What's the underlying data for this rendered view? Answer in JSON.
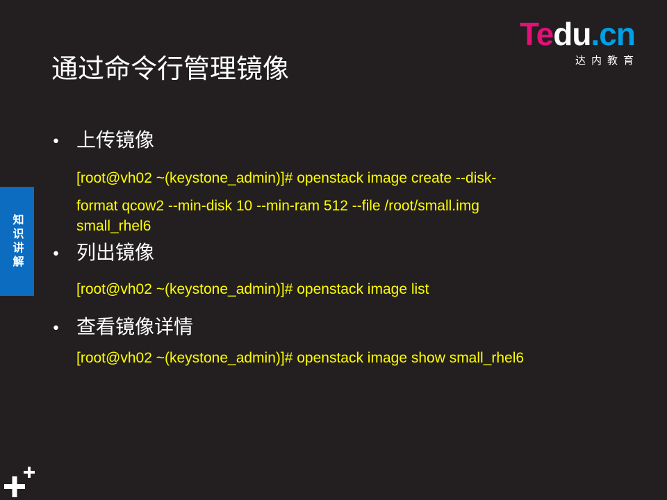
{
  "logo": {
    "mark_part1": "Te",
    "mark_part2": "du",
    "mark_part3": ".cn",
    "subtitle": "达内教育"
  },
  "title": "通过命令行管理镜像",
  "side_tab": "知识讲解",
  "sections": [
    {
      "bullet": "上传镜像",
      "command_lines": [
        "[root@vh02 ~(keystone_admin)]# openstack image create --disk-",
        "format qcow2 --min-disk 10 --min-ram 512 --file /root/small.img",
        "small_rhel6"
      ]
    },
    {
      "bullet": "列出镜像",
      "command_lines": [
        "[root@vh02 ~(keystone_admin)]# openstack image list"
      ]
    },
    {
      "bullet": "查看镜像详情",
      "command_lines": [
        "[root@vh02 ~(keystone_admin)]# openstack image show small_rhel6"
      ]
    }
  ],
  "bullet_symbol": "•",
  "colors": {
    "background": "#231f20",
    "command_text": "#ffff00",
    "side_tab": "#0b6cc0",
    "logo_pink": "#e60f78",
    "logo_blue": "#00a0e9"
  },
  "icons": {
    "corner": "plus-icon"
  }
}
